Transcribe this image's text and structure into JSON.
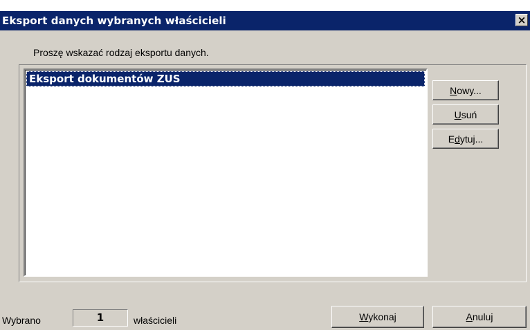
{
  "window": {
    "title": "Eksport danych wybranych właścicieli",
    "close_label": "×"
  },
  "instruction": "Proszę wskazać rodzaj eksportu danych.",
  "export_list": {
    "items": [
      {
        "label": "Eksport dokumentów ZUS",
        "selected": true
      }
    ]
  },
  "side_buttons": {
    "new": {
      "accel": "N",
      "rest": "owy..."
    },
    "delete": {
      "accel": "U",
      "rest": "suń"
    },
    "edit": {
      "pre": "E",
      "accel": "d",
      "rest": "ytuj..."
    }
  },
  "footer": {
    "selected_prefix": "Wybrano",
    "selected_count": "1",
    "selected_suffix": "właścicieli",
    "execute": {
      "accel": "W",
      "rest": "ykonaj"
    },
    "cancel": {
      "accel": "A",
      "rest": "nuluj"
    }
  },
  "colors": {
    "titlebar": "#0a246a",
    "face": "#d4d0c8",
    "selection": "#0a246a"
  }
}
